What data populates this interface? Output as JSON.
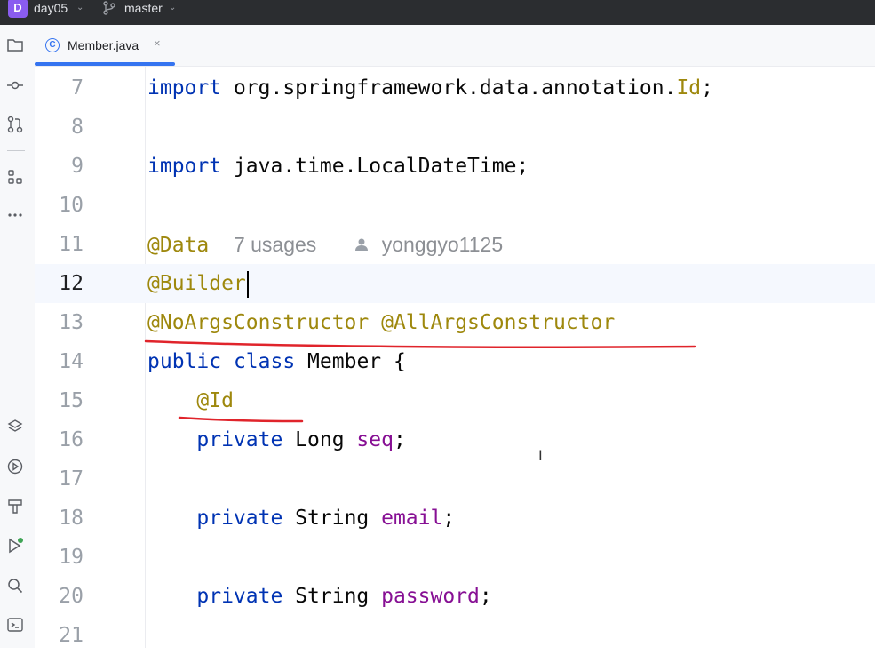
{
  "titlebar": {
    "project_initial": "D",
    "project_name": "day05",
    "branch_name": "master"
  },
  "toolstrip": {
    "top_icons": [
      "folder-icon",
      "commit-icon",
      "pull-requests-icon",
      "structure-icon",
      "more-icon"
    ],
    "bottom_icons": [
      "layers-icon",
      "services-icon",
      "build-hammer-icon",
      "run-icon",
      "search-icon",
      "terminal-icon"
    ]
  },
  "tabs": [
    {
      "label": "Member.java",
      "icon_letter": "C",
      "close": "×",
      "active": true
    }
  ],
  "editor": {
    "lines": [
      {
        "num": "7",
        "tokens": [
          {
            "t": "import",
            "c": "kw"
          },
          {
            "t": " org.springframework.data.annotation."
          },
          {
            "t": "Id",
            "c": "ann"
          },
          {
            "t": ";"
          }
        ]
      },
      {
        "num": "8",
        "tokens": []
      },
      {
        "num": "9",
        "tokens": [
          {
            "t": "import",
            "c": "kw"
          },
          {
            "t": " java.time.LocalDateTime;"
          }
        ]
      },
      {
        "num": "10",
        "tokens": []
      },
      {
        "num": "11",
        "tokens": [
          {
            "t": "@Data",
            "c": "ann"
          }
        ],
        "inlay": {
          "usages": "7 usages",
          "author": "yonggyo1125"
        }
      },
      {
        "num": "12",
        "tokens": [
          {
            "t": "@Builder",
            "c": "ann"
          }
        ],
        "current": true
      },
      {
        "num": "13",
        "tokens": [
          {
            "t": "@NoArgsConstructor",
            "c": "ann"
          },
          {
            "t": " "
          },
          {
            "t": "@AllArgsConstructor",
            "c": "ann"
          }
        ]
      },
      {
        "num": "14",
        "tokens": [
          {
            "t": "public",
            "c": "kw"
          },
          {
            "t": " "
          },
          {
            "t": "class",
            "c": "kw"
          },
          {
            "t": " Member {"
          }
        ]
      },
      {
        "num": "15",
        "tokens": [
          {
            "t": "    "
          },
          {
            "t": "@Id",
            "c": "ann"
          }
        ]
      },
      {
        "num": "16",
        "tokens": [
          {
            "t": "    "
          },
          {
            "t": "private",
            "c": "kw"
          },
          {
            "t": " Long "
          },
          {
            "t": "seq",
            "c": "fld"
          },
          {
            "t": ";"
          }
        ]
      },
      {
        "num": "17",
        "tokens": []
      },
      {
        "num": "18",
        "tokens": [
          {
            "t": "    "
          },
          {
            "t": "private",
            "c": "kw"
          },
          {
            "t": " String "
          },
          {
            "t": "email",
            "c": "fld"
          },
          {
            "t": ";"
          }
        ]
      },
      {
        "num": "19",
        "tokens": []
      },
      {
        "num": "20",
        "tokens": [
          {
            "t": "    "
          },
          {
            "t": "private",
            "c": "kw"
          },
          {
            "t": " String "
          },
          {
            "t": "password",
            "c": "fld"
          },
          {
            "t": ";"
          }
        ]
      },
      {
        "num": "21",
        "tokens": []
      }
    ]
  },
  "colors": {
    "keyword": "#0033b3",
    "annotation": "#9e880d",
    "field": "#871094",
    "accent": "#3574f0",
    "markup_red": "#e0242b"
  }
}
